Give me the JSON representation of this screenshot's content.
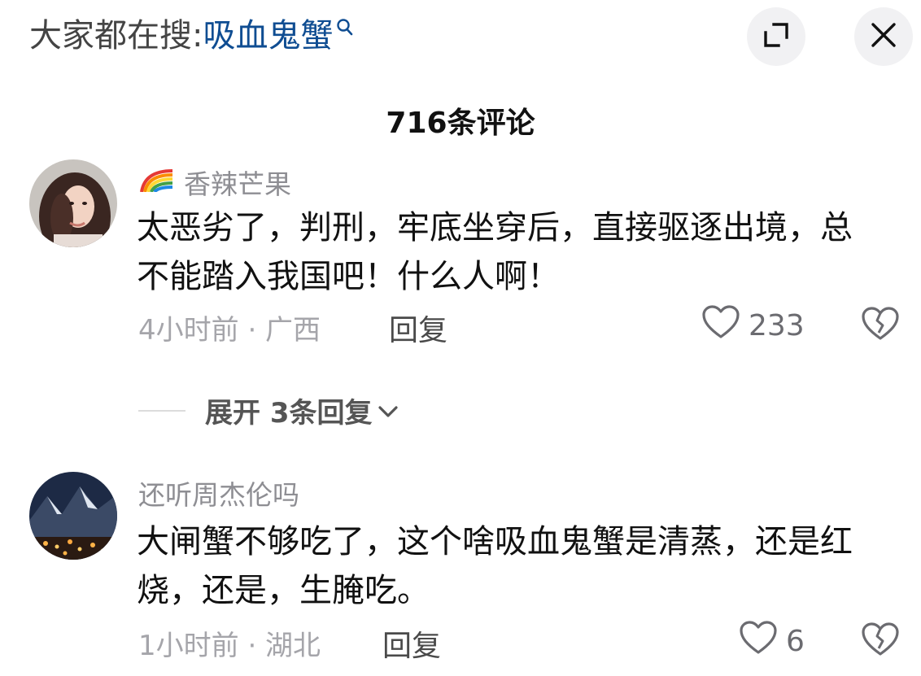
{
  "header": {
    "search_prefix": "大家都在搜:",
    "search_keyword": "吸血鬼蟹",
    "search_icon": "search-icon",
    "expand_icon": "expand-icon",
    "close_icon": "close-icon"
  },
  "comment_count_label": "716条评论",
  "comments": [
    {
      "username": "香辣芒果",
      "username_badge": "rainbow-icon",
      "text": "太恶劣了，判刑，牢底坐穿后，直接驱逐出境，总不能踏入我国吧！什么人啊！",
      "meta": "4小时前 · 广西",
      "reply_label": "回复",
      "likes": "233"
    },
    {
      "username": "还听周杰伦吗",
      "text": "大闸蟹不够吃了，这个啥吸血鬼蟹是清蒸，还是红烧，还是，生腌吃。",
      "meta": "1小时前 · 湖北",
      "reply_label": "回复",
      "likes": "6"
    }
  ],
  "expand_replies_label": "展开 3条回复",
  "colors": {
    "keyword": "#0f4d92",
    "muted": "#a5a5aa",
    "button_bg": "#f1f1f3"
  }
}
